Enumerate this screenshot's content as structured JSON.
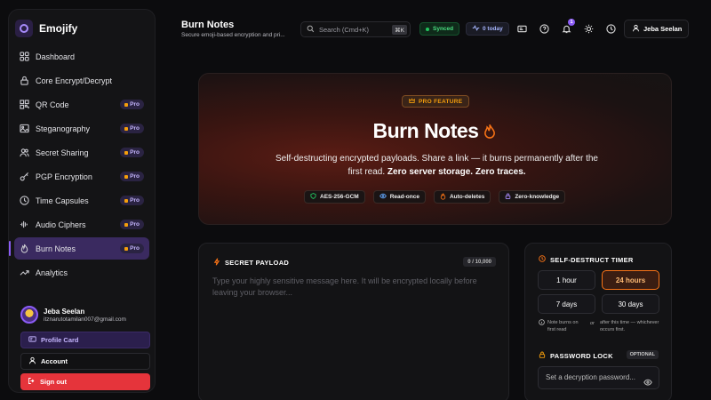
{
  "sidebar": {
    "brand": "Emojify",
    "items": [
      {
        "label": "Dashboard",
        "icon": "grid-icon",
        "pro": ""
      },
      {
        "label": "Core Encrypt/Decrypt",
        "icon": "lock-icon",
        "pro": ""
      },
      {
        "label": "QR Code",
        "icon": "qr-icon",
        "pro": "Pro"
      },
      {
        "label": "Steganography",
        "icon": "image-icon",
        "pro": "Pro"
      },
      {
        "label": "Secret Sharing",
        "icon": "users-icon",
        "pro": "Pro"
      },
      {
        "label": "PGP Encryption",
        "icon": "key-icon",
        "pro": "Pro"
      },
      {
        "label": "Time Capsules",
        "icon": "clock-icon",
        "pro": "Pro"
      },
      {
        "label": "Audio Ciphers",
        "icon": "waveform-icon",
        "pro": "Pro"
      },
      {
        "label": "Burn Notes",
        "icon": "flame-icon",
        "pro": "Pro",
        "active": true
      },
      {
        "label": "Analytics",
        "icon": "trend-icon",
        "pro": ""
      }
    ],
    "user": {
      "name": "Jeba Seelan",
      "email": "itznarutotamilan007@gmail.com"
    },
    "profile_card": "Profile Card",
    "account": "Account",
    "sign_out": "Sign out"
  },
  "header": {
    "title": "Burn Notes",
    "subtitle": "Secure emoji-based encryption and pri...",
    "search_placeholder": "Search (Cmd+K)",
    "search_kbd": "⌘K",
    "synced": "Synced",
    "today": "0 today",
    "notification_count": "1",
    "user": "Jeba Seelan"
  },
  "hero": {
    "badge": "PRO FEATURE",
    "title": "Burn Notes",
    "desc_plain": "Self-destructing encrypted payloads. Share a link — it burns permanently after the first read.",
    "desc_bold": "Zero server storage. Zero traces.",
    "tags": [
      {
        "label": "AES-256-GCM",
        "color": "#22c55e"
      },
      {
        "label": "Read-once",
        "color": "#60a5fa"
      },
      {
        "label": "Auto-deletes",
        "color": "#f97316"
      },
      {
        "label": "Zero-knowledge",
        "color": "#a78bfa"
      }
    ]
  },
  "payload": {
    "title": "SECRET PAYLOAD",
    "count": "0 / 10,000",
    "placeholder": "Type your highly sensitive message here. It will be encrypted locally before leaving your browser..."
  },
  "timer": {
    "title": "SELF-DESTRUCT TIMER",
    "options": [
      "1 hour",
      "24 hours",
      "7 days",
      "30 days"
    ],
    "selected": "24 hours",
    "note_left": "Note burns on first read",
    "note_or": "or",
    "note_right": "after this time — whichever occurs first."
  },
  "password": {
    "title": "PASSWORD LOCK",
    "optional": "OPTIONAL",
    "placeholder": "Set a decryption password..."
  },
  "colors": {
    "accent": "#8b5cf6",
    "flame": "#f97316",
    "danger": "#e5343b",
    "success": "#22c55e"
  }
}
